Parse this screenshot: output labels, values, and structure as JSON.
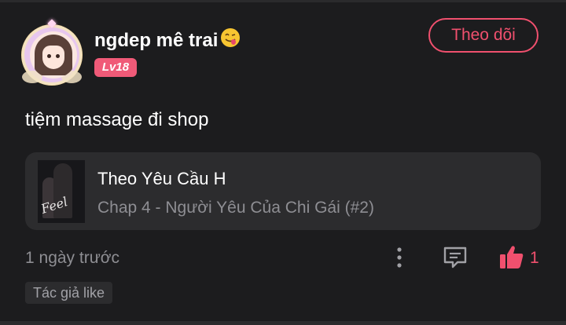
{
  "user": {
    "name": "ngdep mê trai",
    "emoji": "smiling-face-with-tongue-emoji",
    "level": "Lv18"
  },
  "follow_button": {
    "label": "Theo dõi"
  },
  "post": {
    "text": "tiệm massage đi shop",
    "timestamp": "1 ngày trước",
    "like_count": "1",
    "author_tag": "Tác giả like"
  },
  "story": {
    "title": "Theo Yêu Cầu H",
    "chapter": "Chap 4 - Người Yêu Của Chi Gái (#2)",
    "cover_text": "Feel"
  },
  "icons": {
    "more": "more-vertical-icon",
    "comment": "comment-icon",
    "like": "thumbs-up-icon"
  },
  "colors": {
    "background": "#1c1c1e",
    "accent": "#f0506e",
    "level_badge": "#f05a78",
    "card": "#2c2c2e",
    "muted_text": "#8e8e93"
  }
}
